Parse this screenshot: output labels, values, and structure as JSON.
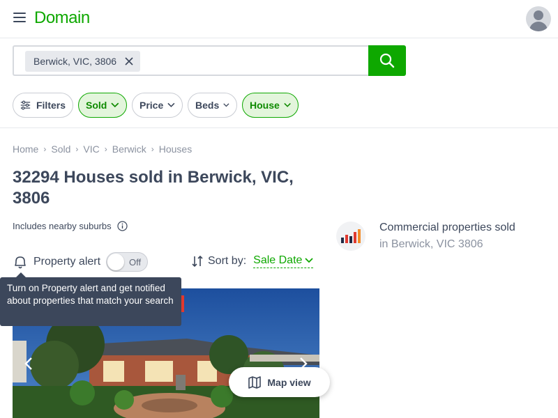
{
  "header": {
    "logo": "Domain"
  },
  "search": {
    "chip": "Berwick, VIC, 3806"
  },
  "filters": {
    "filters_label": "Filters",
    "sold_label": "Sold",
    "price_label": "Price",
    "beds_label": "Beds",
    "house_label": "House"
  },
  "breadcrumb": [
    "Home",
    "Sold",
    "VIC",
    "Berwick",
    "Houses"
  ],
  "page": {
    "title": "32294 Houses sold in Berwick, VIC, 3806",
    "nearby": "Includes nearby suburbs"
  },
  "alert": {
    "label": "Property alert",
    "toggle_state": "Off",
    "tooltip": "Turn on Property alert and get notified about properties that match your search"
  },
  "sort": {
    "label": "Sort by:",
    "value": "Sale Date"
  },
  "commercial": {
    "title": "Commercial properties sold",
    "subtitle": "in Berwick, VIC 3806"
  },
  "map": {
    "label": "Map view"
  },
  "colors": {
    "brand": "#0ea800",
    "text": "#3c475b",
    "muted": "#8b92a0"
  }
}
